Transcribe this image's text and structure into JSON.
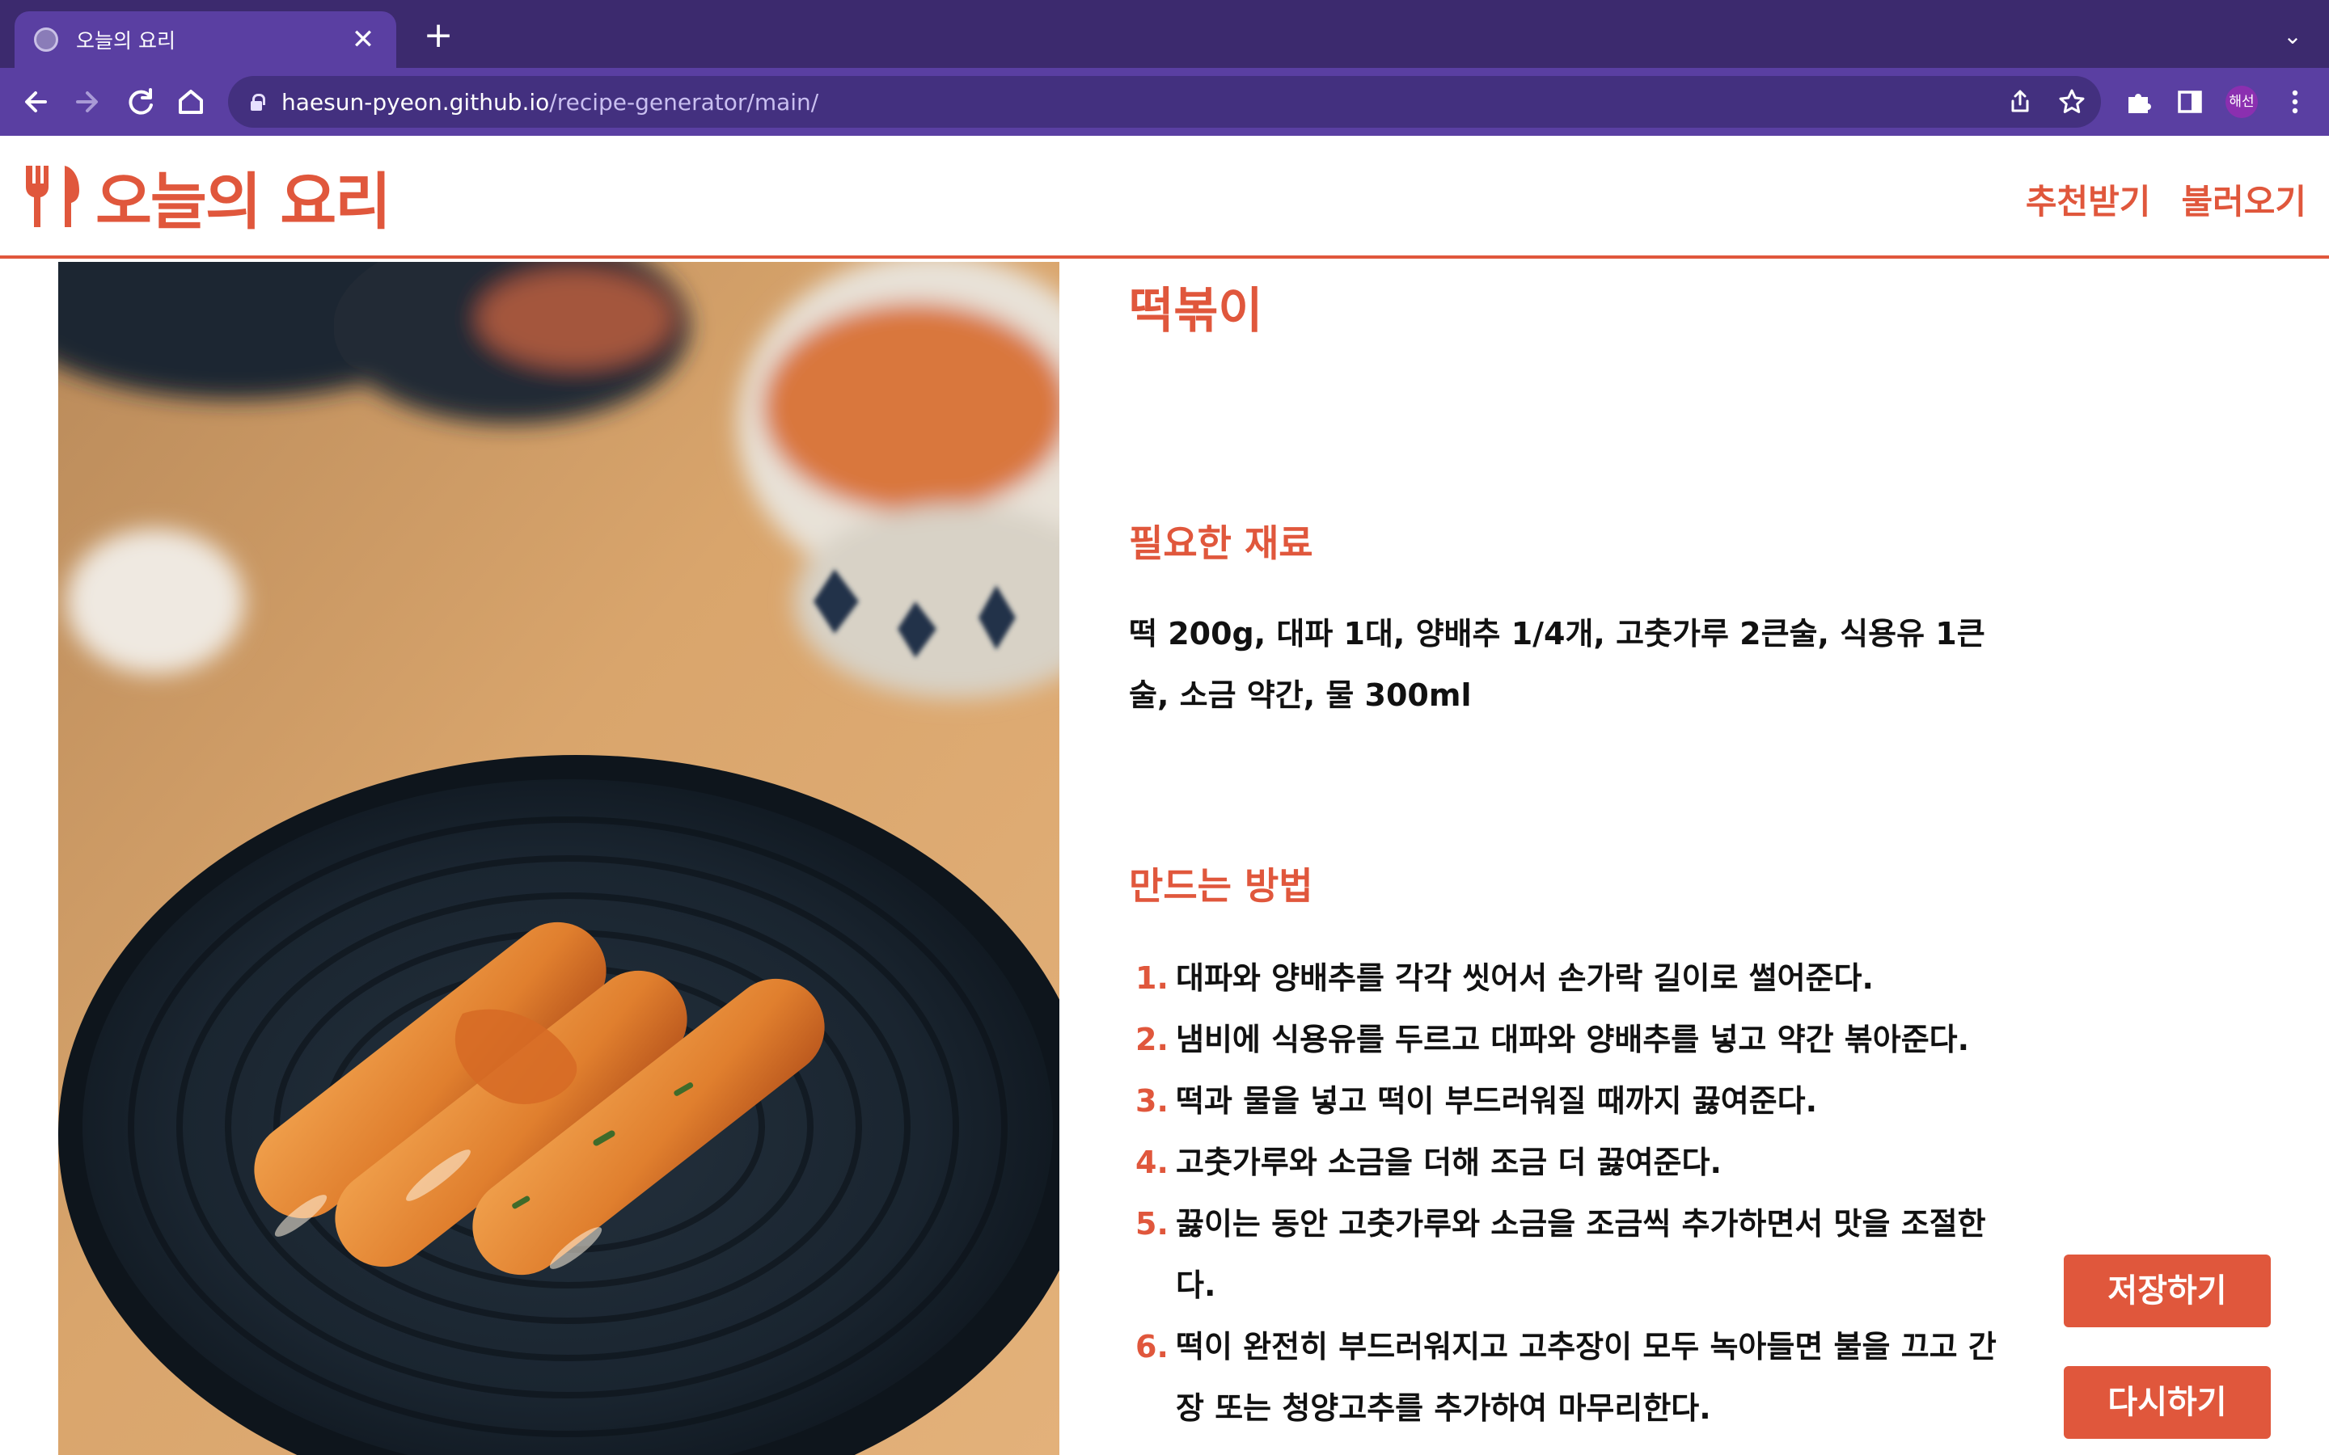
{
  "browser": {
    "tab_title": "오늘의 요리",
    "tab_close": "✕",
    "new_tab": "+",
    "tab_menu": "⌄",
    "url_host": "haesun-pyeon.github.io",
    "url_path": "/recipe-generator/main/",
    "profile": "해선"
  },
  "site": {
    "logo_text": "오늘의 요리",
    "nav": [
      "추천받기",
      "불러오기"
    ]
  },
  "recipe": {
    "title": "떡볶이",
    "ingredients_heading": "필요한 재료",
    "ingredients": "떡 200g, 대파 1대, 양배추 1/4개, 고춧가루 2큰술, 식용유 1큰술, 소금 약간, 물 300ml",
    "steps_heading": "만드는 방법",
    "steps": [
      {
        "num": "1.",
        "text": "대파와 양배추를 각각 씻어서 손가락 길이로 썰어준다."
      },
      {
        "num": "2.",
        "text": "냄비에 식용유를 두르고 대파와 양배추를 넣고 약간 볶아준다."
      },
      {
        "num": "3.",
        "text": "떡과 물을 넣고 떡이 부드러워질 때까지 끓여준다."
      },
      {
        "num": "4.",
        "text": "고춧가루와 소금을 더해 조금 더 끓여준다."
      },
      {
        "num": "5.",
        "text": "끓이는 동안 고춧가루와 소금을 조금씩 추가하면서 맛을 조절한다."
      },
      {
        "num": "6.",
        "text": "떡이 완전히 부드러워지고 고추장이 모두 녹아들면 불을 끄고 간장 또는 청양고추를 추가하여 마무리한다."
      }
    ]
  },
  "actions": {
    "save": "저장하기",
    "retry": "다시하기"
  },
  "colors": {
    "accent": "#e0573c",
    "chrome_dark": "#3c2a6e",
    "chrome": "#5a3fa2"
  },
  "icons": {
    "logo": "fork-spoon-icon",
    "back": "arrow-left-icon",
    "forward": "arrow-right-icon",
    "reload": "reload-icon",
    "home": "home-icon",
    "share": "share-icon",
    "bookmark": "star-icon",
    "extensions": "puzzle-icon",
    "sidepanel": "side-panel-icon",
    "menu": "kebab-menu-icon"
  }
}
